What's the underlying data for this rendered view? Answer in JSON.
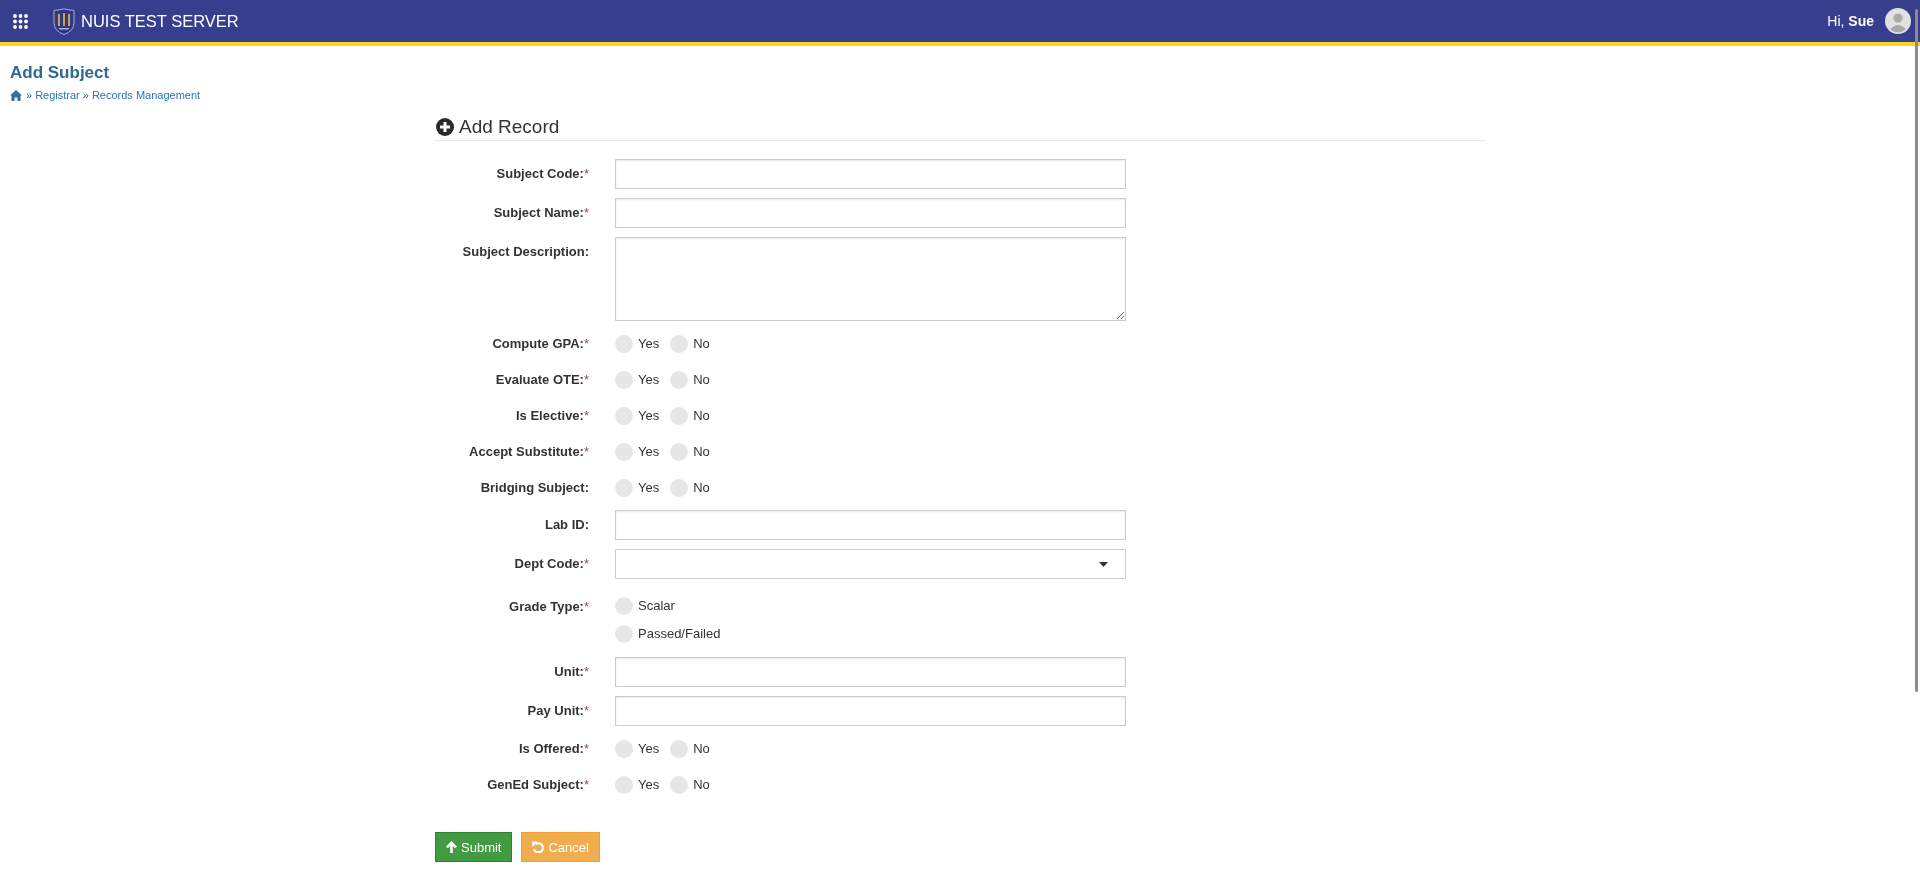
{
  "header": {
    "title": "NUIS TEST SERVER",
    "greeting": "Hi, **Sue**"
  },
  "page": {
    "title": "Add Subject",
    "breadcrumb": [
      {
        "separator": "»",
        "label": "Registrar"
      },
      {
        "separator": "»",
        "label": "Records Management"
      }
    ]
  },
  "form": {
    "title": "Add Record",
    "fields": [
      {
        "kind": "text",
        "label": "Subject Code:",
        "required_mark": "*"
      },
      {
        "kind": "text",
        "label": "Subject Name:",
        "required_mark": "*"
      },
      {
        "kind": "textarea",
        "label": "Subject Description:"
      },
      {
        "kind": "yesno",
        "label": "Compute GPA:",
        "required_mark": "*",
        "options": [
          {
            "label": "Yes",
            "selected": false
          },
          {
            "label": "No",
            "selected": false
          }
        ]
      },
      {
        "kind": "yesno",
        "label": "Evaluate OTE:",
        "required_mark": "*",
        "options": [
          {
            "label": "Yes",
            "selected": false
          },
          {
            "label": "No",
            "selected": false
          }
        ]
      },
      {
        "kind": "yesno",
        "label": "Is Elective:",
        "required_mark": "*",
        "options": [
          {
            "label": "Yes",
            "selected": false
          },
          {
            "label": "No",
            "selected": false
          }
        ]
      },
      {
        "kind": "yesno",
        "label": "Accept Substitute:",
        "required_mark": "*",
        "options": [
          {
            "label": "Yes",
            "selected": false
          },
          {
            "label": "No",
            "selected": false
          }
        ]
      },
      {
        "kind": "yesno",
        "label": "Bridging Subject:",
        "options": [
          {
            "label": "Yes",
            "selected": false
          },
          {
            "label": "No",
            "selected": false
          }
        ]
      },
      {
        "kind": "text",
        "label": "Lab ID:"
      },
      {
        "kind": "select",
        "label": "Dept Code:",
        "required_mark": "*"
      },
      {
        "kind": "radio",
        "label": "Grade Type:",
        "required_mark": "*",
        "options": [
          {
            "label": "Scalar",
            "selected": false
          },
          {
            "label": "Passed/Failed",
            "selected": false
          }
        ]
      },
      {
        "kind": "text",
        "label": "Unit:",
        "required_mark": "*"
      },
      {
        "kind": "text",
        "label": "Pay Unit:",
        "required_mark": "*"
      },
      {
        "kind": "yesno",
        "label": "Is Offered:",
        "required_mark": "*",
        "options": [
          {
            "label": "Yes",
            "selected": false
          },
          {
            "label": "No",
            "selected": false
          }
        ]
      },
      {
        "kind": "yesno",
        "label": "GenEd Subject:",
        "required_mark": "*",
        "options": [
          {
            "label": "Yes",
            "selected": false
          },
          {
            "label": "No",
            "selected": false
          }
        ]
      }
    ],
    "buttons": [
      {
        "kind": "submit",
        "label": "Submit"
      },
      {
        "kind": "cancel",
        "label": "Cancel"
      }
    ]
  }
}
